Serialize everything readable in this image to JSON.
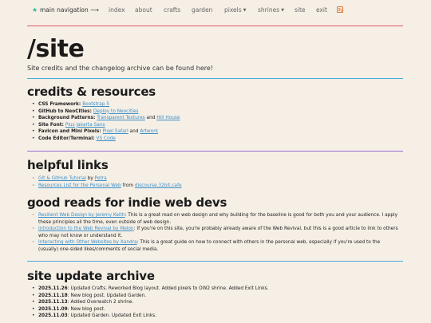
{
  "nav": {
    "main": "main navigation ⟶",
    "items": [
      {
        "label": "index"
      },
      {
        "label": "about"
      },
      {
        "label": "crafts"
      },
      {
        "label": "garden"
      },
      {
        "label": "pixels"
      },
      {
        "label": "shrines"
      },
      {
        "label": "site"
      },
      {
        "label": "exit"
      }
    ]
  },
  "page": {
    "title": "/site",
    "subtitle": "Site credits and the changelog archive can be found here!"
  },
  "credits": {
    "heading": "credits & resources",
    "items": [
      {
        "label": "CSS Framework: ",
        "link": "Bootstrap 5"
      },
      {
        "label": "GitHub to NeoCities: ",
        "link": "Deploy to Neocities"
      },
      {
        "label": "Background Patterns: ",
        "link": "Transparent Textures",
        "mid": " and ",
        "link2": "Hill House"
      },
      {
        "label": "Site Font: ",
        "link": "Plus Jakarta Sans"
      },
      {
        "label": "Favicon and Mini Pixels: ",
        "link": "Pixel Safari",
        "mid": " and ",
        "link2": "Artwork"
      },
      {
        "label": "Code Editor/Terminal: ",
        "link": "VS Code"
      }
    ]
  },
  "helpful": {
    "heading": "helpful links",
    "items": [
      {
        "link": "Git & GitHub Tutorial",
        "rest": " by ",
        "link2": "Petra"
      },
      {
        "link": "Resources List for the Personal Web",
        "rest": " from ",
        "link2": "discourse.32bit.cafe"
      }
    ]
  },
  "reads": {
    "heading": "good reads for indie web devs",
    "items": [
      {
        "link": "Resilient Web Design by Jeremy Keith",
        "rest": ": This is a great read on web design and why building for the baseline is good for both you and your audience. I apply these principles all the time, even outside of web design."
      },
      {
        "link": "Introduction to the Web Revival by Melon",
        "rest": ": If you're on this site, you're probably already aware of the Web Revival, but this is a good article to link to others who may not know or understand it."
      },
      {
        "link": "Interacting with Other Websites by Xandra",
        "rest": ": This is a great guide on how to connect with others in the personal web, especially if you're used to the (usually) one-sided likes/comments of social media."
      }
    ]
  },
  "archive": {
    "heading": "site update archive",
    "items": [
      {
        "date": "2025.11.26",
        "text": ": Updated Crafts. Reworked Blog layout. Added pixels to OW2 shrine. Added Exit Links."
      },
      {
        "date": "2025.11.18",
        "text": ": New blog post. Updated Garden."
      },
      {
        "date": "2025.11.13",
        "text": ": Added Overwatch 2 shrine."
      },
      {
        "date": "2025.11.09",
        "text": ": New blog post."
      },
      {
        "date": "2025.11.03",
        "text": ": Updated Garden. Updated Exit Links."
      }
    ]
  },
  "colors": {
    "background": "#f6efe6",
    "rule_red": "#e0566b",
    "rule_blue": "#46a7d8",
    "rule_purple": "#9b6fd6",
    "link": "#3b8fc7",
    "accent_star": "#2fb59a",
    "rss": "#e07a2e"
  },
  "icons": {
    "star": "star-icon",
    "rss": "rss-icon"
  }
}
